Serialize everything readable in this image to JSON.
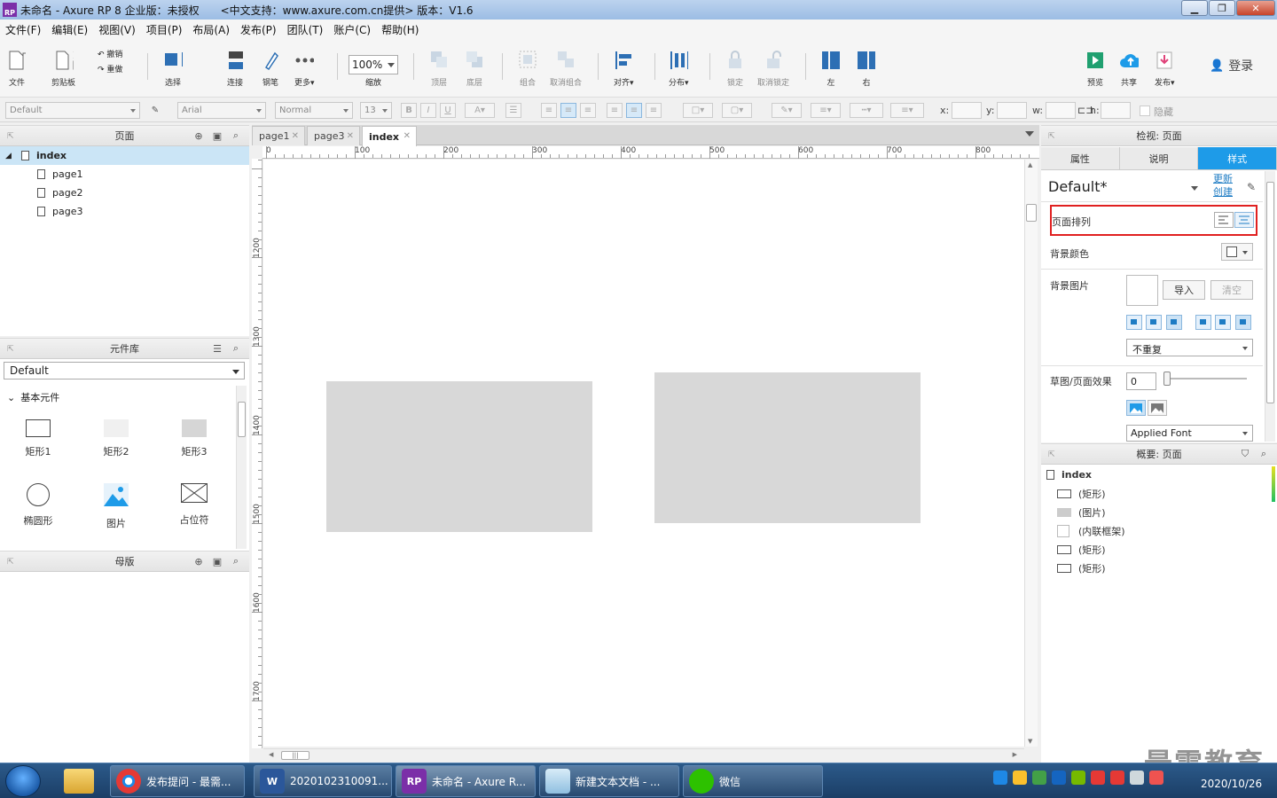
{
  "window": {
    "title": "未命名 - Axure RP 8 企业版：未授权　　<中文支持：www.axure.com.cn提供> 版本：V1.6",
    "logo_text": "RP"
  },
  "menu": [
    "文件(F)",
    "编辑(E)",
    "视图(V)",
    "项目(P)",
    "布局(A)",
    "发布(P)",
    "团队(T)",
    "账户(C)",
    "帮助(H)"
  ],
  "toolbar": {
    "file": "文件",
    "clipboard": "剪贴板",
    "undo": "撤销",
    "redo": "重做",
    "select": "选择",
    "connect": "连接",
    "pen": "钢笔",
    "more": "更多▾",
    "zoom_value": "100%",
    "zoom": "缩放",
    "top": "顶层",
    "bottom": "底层",
    "group": "组合",
    "ungroup": "取消组合",
    "align": "对齐▾",
    "distribute": "分布▾",
    "lock": "锁定",
    "unlock": "取消锁定",
    "left": "左",
    "right": "右",
    "preview": "预览",
    "share": "共享",
    "publish": "发布▾",
    "login": "登录"
  },
  "format": {
    "style": "Default",
    "font": "Arial",
    "weight": "Normal",
    "size": "13",
    "x": "x:",
    "y": "y:",
    "w": "w:",
    "h": "h:",
    "hide": "隐藏"
  },
  "pages_panel": {
    "title": "页面",
    "root": "index",
    "children": [
      "page1",
      "page2",
      "page3"
    ]
  },
  "library_panel": {
    "title": "元件库",
    "selected": "Default",
    "group": "基本元件",
    "widgets": [
      "矩形1",
      "矩形2",
      "矩形3",
      "椭圆形",
      "图片",
      "占位符"
    ]
  },
  "master_panel": {
    "title": "母版"
  },
  "canvas": {
    "tabs": [
      "page1",
      "page3",
      "index"
    ],
    "active_tab": "index",
    "hruler": [
      "0",
      "100",
      "200",
      "300",
      "400",
      "500",
      "600",
      "700",
      "800"
    ],
    "vruler": [
      "1200",
      "1300",
      "1400",
      "1500",
      "1600",
      "1700"
    ]
  },
  "inspector": {
    "title": "检视: 页面",
    "tabs": [
      "属性",
      "说明",
      "样式"
    ],
    "active_tab": "样式",
    "style_name": "Default*",
    "update": "更新",
    "create": "创建",
    "page_align": "页面排列",
    "bg_color": "背景颜色",
    "bg_image": "背景图片",
    "import": "导入",
    "clear": "清空",
    "repeat": "不重复",
    "sketch": "草图/页面效果",
    "sketch_value": "0",
    "font": "Applied Font",
    "highlight_color": "#e02020"
  },
  "outline": {
    "title": "概要: 页面",
    "root": "index",
    "items": [
      "(矩形)",
      "(图片)",
      "(内联框架)",
      "(矩形)",
      "(矩形)"
    ]
  },
  "taskbar": {
    "items": [
      "发布提问 - 最需...",
      "2020102310091...",
      "未命名 - Axure R...",
      "新建文本文档 - ...",
      "微信"
    ],
    "time": "2020/10/26"
  },
  "watermark": "最需教育"
}
